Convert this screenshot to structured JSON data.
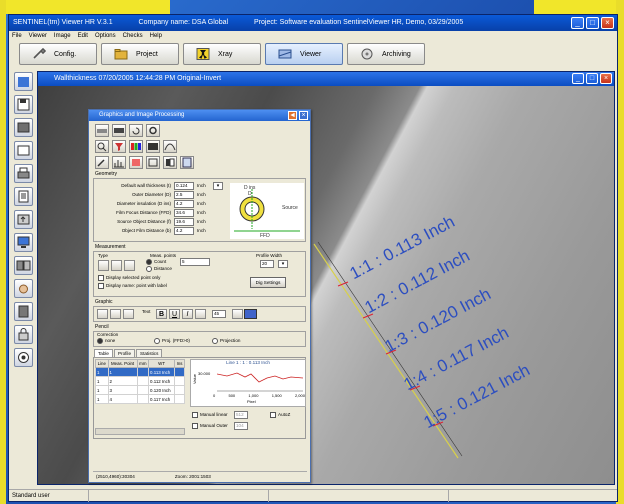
{
  "window": {
    "title_app": "SENTINEL(tm) Viewer HR V.3.1",
    "title_company": "Company name: DSA Global",
    "title_project": "Project: Software evaluation SentinelViewer HR, Demo, 03/29/2005",
    "btn_min": "_",
    "btn_max": "□",
    "btn_close": "×"
  },
  "menu": [
    "File",
    "Viewer",
    "Image",
    "Edit",
    "Options",
    "Checks",
    "Help"
  ],
  "tabs": [
    {
      "label": "Config.",
      "icon": "wrench-icon"
    },
    {
      "label": "Project",
      "icon": "folder-icon"
    },
    {
      "label": "Xray",
      "icon": "radiation-icon"
    },
    {
      "label": "Viewer",
      "icon": "viewer-icon"
    },
    {
      "label": "Archiving",
      "icon": "archive-icon"
    }
  ],
  "document": {
    "title": "Wallthickness 07/20/2005 12:44:28 PM Original-Invert"
  },
  "panel": {
    "title": "Graphics and Image Processing",
    "geometry_label": "Geometry",
    "geometry_fields": [
      {
        "label": "Default wall thickness (t)",
        "value": "0.124",
        "unit": "Inch"
      },
      {
        "label": "Outer Diameter (D)",
        "value": "2.5",
        "unit": "Inch"
      },
      {
        "label": "Diameter insulation (D ins)",
        "value": "4.2",
        "unit": "Inch"
      },
      {
        "label": "Film Focus Distance (FFD)",
        "value": "34.6",
        "unit": "Inch"
      },
      {
        "label": "Source Object Distance (f)",
        "value": "19.6",
        "unit": "Inch"
      },
      {
        "label": "Object Film Distance (b)",
        "value": "4.2",
        "unit": "Inch"
      }
    ],
    "diagram_labels": {
      "d_ins": "D ins",
      "d": "D",
      "source": "Source",
      "ffd": "FFD"
    },
    "measurement_label": "Measurement",
    "type_label": "Type",
    "meas_points_label": "Meas. points",
    "meas_points_value": "5",
    "opt_count": "Count",
    "opt_distance": "Distance",
    "profile_width_label": "Profile Width",
    "profile_width_value": "20",
    "display_selected": "Display selected point only",
    "display_names": "Display name: point with label",
    "dig_settings": "Dig Settings",
    "graphic_label": "Graphic",
    "text_label": "Text",
    "font_size": "45",
    "pencil_label": "Pencil",
    "correction_label": "Correction",
    "corr_none": "none",
    "corr_proj": "Proj. (FFD>0)",
    "corr_projection": "Projection",
    "subtabs": [
      "Table",
      "Profile",
      "Statistics"
    ],
    "table_headers": [
      "Line",
      "Meas. Point",
      "mm",
      "WT",
      "Ins"
    ],
    "table_rows": [
      [
        "1",
        "1",
        "",
        "0.113 Inch",
        ""
      ],
      [
        "1",
        "2",
        "",
        "0.112 Inch",
        ""
      ],
      [
        "1",
        "3",
        "",
        "0.120 Inch",
        ""
      ],
      [
        "1",
        "4",
        "",
        "0.117 Inch",
        ""
      ]
    ],
    "chart_title": "Line 1 : 1 : 0.113 Inch",
    "chart_ylabel": "Value",
    "chart_ytick": "30.000",
    "chart_xticks": [
      "0",
      "500",
      "1,000",
      "1,500",
      "2,000"
    ],
    "chart_xlabel": "Pixel",
    "manual_linear": "Manual linear",
    "manual_outer": "Manual Outer",
    "auto_z": "AutoZ",
    "val1": "512",
    "val2": "104",
    "status_left": "(2510,4960):30304",
    "status_right": "Zoom: 2001:1503"
  },
  "measurements": [
    "1:1 : 0.113 Inch",
    "1:2 : 0.112 Inch",
    "1:3 : 0.120 Inch",
    "1:4 : 0.117 Inch",
    "1:5 : 0.121 Inch"
  ],
  "status": {
    "left": "Standard user"
  },
  "colors": {
    "accent": "#2c4ec0",
    "title_bar": "#0a5ad8",
    "frame": "#1d58b8",
    "frame_trim": "#f1e62a"
  }
}
